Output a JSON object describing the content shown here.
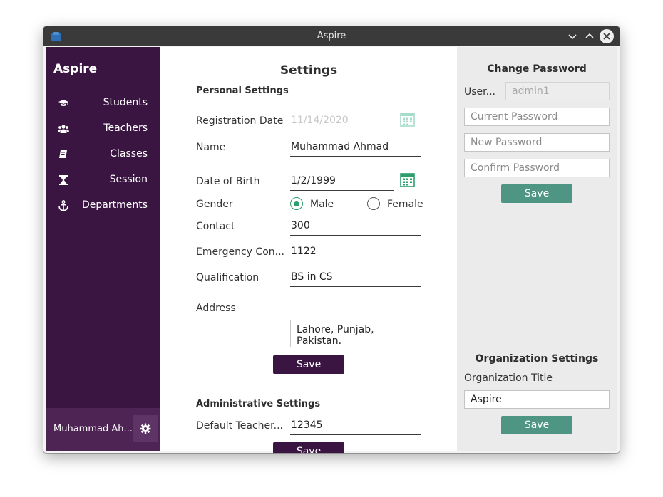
{
  "window": {
    "title": "Aspire"
  },
  "sidebar": {
    "brand": "Aspire",
    "items": [
      {
        "label": "Students",
        "icon": "graduation-cap-icon"
      },
      {
        "label": "Teachers",
        "icon": "users-icon"
      },
      {
        "label": "Classes",
        "icon": "book-icon"
      },
      {
        "label": "Session",
        "icon": "hourglass-icon"
      },
      {
        "label": "Departments",
        "icon": "anchor-icon"
      }
    ],
    "user_name": "Muhammad Ah...",
    "settings_icon": "gear-icon"
  },
  "main": {
    "title": "Settings",
    "personal": {
      "title": "Personal Settings",
      "registration_date": {
        "label": "Registration Date",
        "value": "11/14/2020"
      },
      "name": {
        "label": "Name",
        "value": "Muhammad Ahmad"
      },
      "dob": {
        "label": "Date of Birth",
        "value": "1/2/1999"
      },
      "gender": {
        "label": "Gender",
        "male": "Male",
        "female": "Female",
        "selected": "Male"
      },
      "contact": {
        "label": "Contact",
        "value": "300"
      },
      "emergency": {
        "label": "Emergency Con...",
        "value": "1122"
      },
      "qualification": {
        "label": "Qualification",
        "value": "BS in CS"
      },
      "address": {
        "label": "Address",
        "value": "Lahore, Punjab, Pakistan."
      },
      "save_label": "Save"
    },
    "admin": {
      "title": "Administrative Settings",
      "default_teacher": {
        "label": "Default Teacher...",
        "value": "12345"
      },
      "save_label": "Save"
    }
  },
  "password": {
    "title": "Change Password",
    "user_label": "User...",
    "user_value": "admin1",
    "current_placeholder": "Current Password",
    "new_placeholder": "New Password",
    "confirm_placeholder": "Confirm Password",
    "save_label": "Save"
  },
  "organization": {
    "title": "Organization Settings",
    "title_label": "Organization Title",
    "title_value": "Aspire",
    "save_label": "Save"
  },
  "colors": {
    "sidebar": "#3a1541",
    "accent_purple": "#3a1541",
    "accent_green": "#4e9683",
    "radio_checked": "#2e9e6e"
  }
}
